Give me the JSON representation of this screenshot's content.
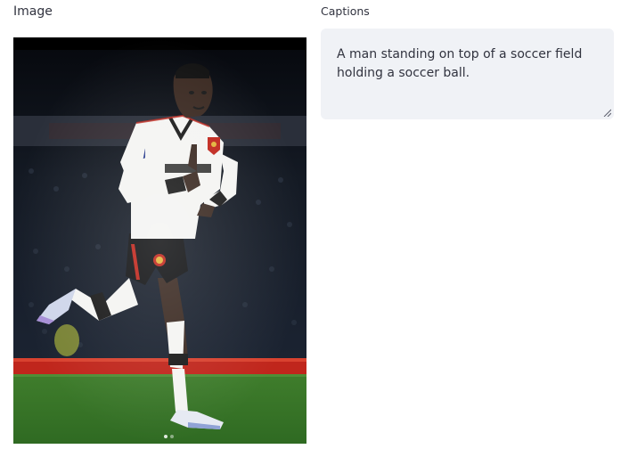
{
  "left_column": {
    "label": "Image"
  },
  "right_column": {
    "label": "Captions",
    "caption_text": "A man standing on top of a soccer field holding a soccer ball."
  },
  "colors": {
    "text": "#31333f",
    "caption_bg": "#f0f2f6",
    "pitch_green": "#3e7a2c",
    "ad_board_red": "#c0261c"
  }
}
